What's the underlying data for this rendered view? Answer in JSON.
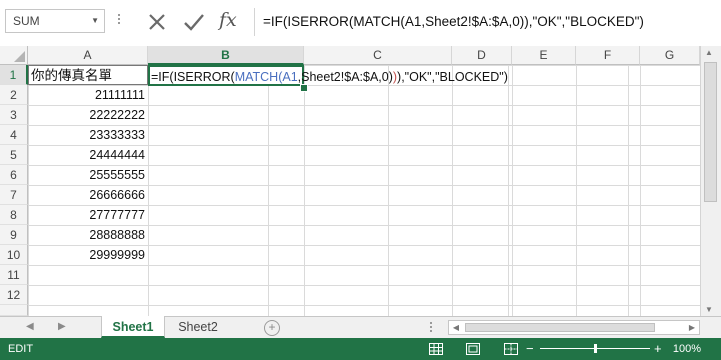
{
  "name_box": {
    "value": "SUM"
  },
  "formula_bar": {
    "cancel_icon": "cancel-x-icon",
    "enter_icon": "checkmark-icon",
    "function_icon": "fx-icon",
    "function_label": "fx",
    "formula": "=IF(ISERROR(MATCH(A1,Sheet2!$A:$A,0)),\"OK\",\"BLOCKED\")"
  },
  "columns": [
    "A",
    "B",
    "C",
    "D",
    "E",
    "F",
    "G"
  ],
  "active_column": "B",
  "rows": [
    "1",
    "2",
    "3",
    "4",
    "5",
    "6",
    "7",
    "8",
    "9",
    "10",
    "11",
    "12"
  ],
  "active_row": "1",
  "cells": {
    "a1": "你的傳真名單",
    "a2": "21111111",
    "a3": "22222222",
    "a4": "23333333",
    "a5": "24444444",
    "a6": "25555555",
    "a7": "26666666",
    "a8": "27777777",
    "a9": "28888888",
    "a10": "29999999",
    "b1": {
      "p1": "=IF(ISERROR(",
      "p2": "MATCH(",
      "p3": "A1",
      "p4": ",Sheet2!$A:$A,0)",
      "p5": ")",
      "p6": "),\"OK\",\"BLOCKED\")"
    }
  },
  "sheet_tabs": [
    {
      "label": "Sheet1",
      "active": true
    },
    {
      "label": "Sheet2",
      "active": false
    }
  ],
  "add_sheet_label": "+",
  "status_bar": {
    "mode": "EDIT",
    "zoom_minus": "−",
    "zoom_plus": "+",
    "zoom_level": "100%"
  },
  "colors": {
    "accent": "#217346",
    "ref_blue": "#4a6fbf",
    "ref_red": "#c0504d"
  }
}
